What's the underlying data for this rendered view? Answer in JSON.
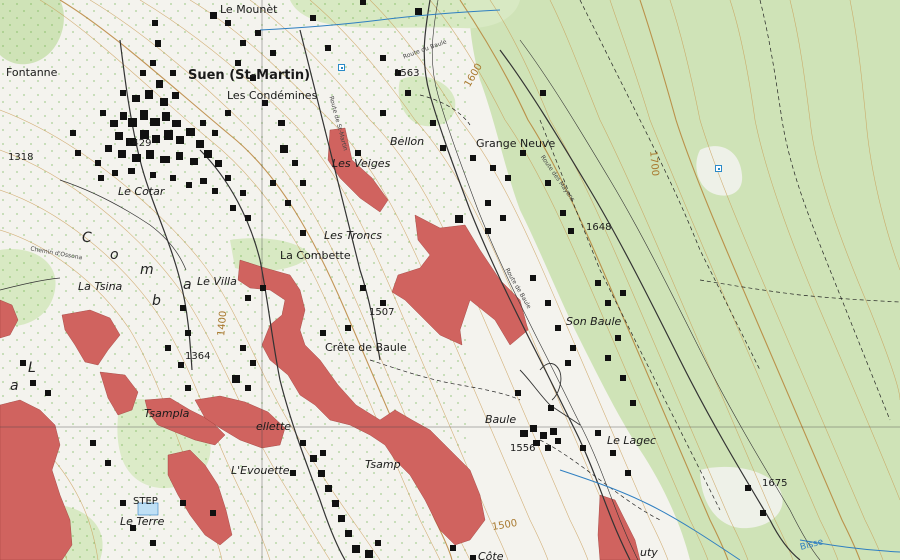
{
  "places": {
    "suen": "Suen (St-Martin)",
    "le_mounet": "Le Mounèt",
    "fontanne": "Fontanne",
    "les_condemines": "Les Condémines",
    "bellon": "Bellon",
    "grange_neuve": "Grange Neuve",
    "le_cotar": "Le Cotar",
    "les_veiges": "Les Veiges",
    "les_troncs": "Les Troncs",
    "la_combette": "La Combette",
    "la_tsina": "La Tsina",
    "le_villa": "Le Villa",
    "son_baule": "Son Baule",
    "crete_de_baule": "Crête de Baule",
    "tsampla": "Tsampla",
    "baule": "Baule",
    "le_lagec": "Le Lagec",
    "ellette": "ellette",
    "tsamp": "Tsamp",
    "l_evouette": "L'Evouette",
    "le_terre": "Le Terre",
    "step": "STEP",
    "cote": "Côte",
    "uty": "uty"
  },
  "elevations": {
    "e1563": "1563",
    "e1429": "1429",
    "e1318": "1318",
    "e1648": "1648",
    "e1507": "1507",
    "e1364": "1364",
    "e1556": "1556",
    "e1675": "1675"
  },
  "contour_labels": {
    "c1600": "1600",
    "c1700": "1700",
    "c1400": "1400",
    "c1500": "1500"
  },
  "region_label": {
    "letters": [
      "C",
      "o",
      "m",
      "b",
      "a",
      "L",
      "a"
    ]
  },
  "road_labels": {
    "route_du_beule": "Route du Baule",
    "route_des_mayens": "Route des Mayens",
    "chemin_ossona": "Chemin d'Ossona",
    "route_du_vieux": "Route de Baule",
    "route_st_martin": "Route de St-Martin"
  },
  "water_label": "Bisse",
  "colors": {
    "forest": "#cfe3b7",
    "open": "#f4f3ee",
    "rock": "#d0635f",
    "contour": "#c89a52",
    "building": "#111111",
    "water": "#2f7fc1"
  },
  "icons": {
    "poi": "info-square-icon"
  }
}
